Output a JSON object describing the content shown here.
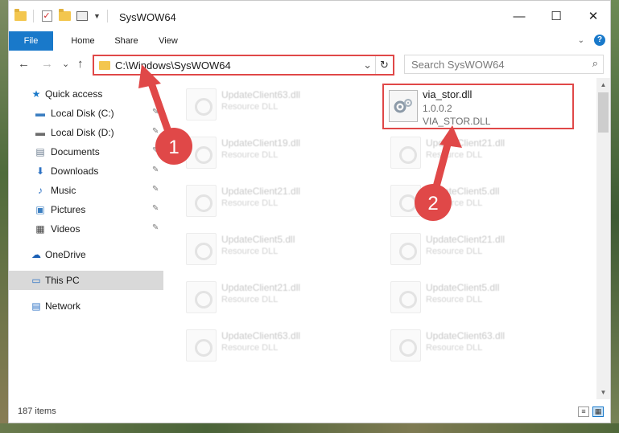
{
  "window": {
    "title": "SysWOW64",
    "controls": {
      "minimize": "—",
      "maximize": "☐",
      "close": "✕"
    }
  },
  "ribbon": {
    "tabs": [
      {
        "label": "File"
      },
      {
        "label": "Home"
      },
      {
        "label": "Share"
      },
      {
        "label": "View"
      }
    ],
    "collapse_glyph": "⌄",
    "help_glyph": "?"
  },
  "nav": {
    "back": "←",
    "forward": "→",
    "recent": "⌄",
    "up": "↑"
  },
  "address": {
    "path": "C:\\Windows\\SysWOW64",
    "drop_glyph": "⌄",
    "refresh_glyph": "↻"
  },
  "search": {
    "placeholder": "Search SysWOW64",
    "icon_glyph": "⌕"
  },
  "sidebar": {
    "items": [
      {
        "label": "Quick access",
        "icon": "star-icon",
        "glyph": "★",
        "color": "#1979ca"
      },
      {
        "label": "Local Disk (C:)",
        "icon": "drive-icon",
        "glyph": "▬",
        "color": "#3c7fc1",
        "pinned": true
      },
      {
        "label": "Local Disk (D:)",
        "icon": "drive-icon",
        "glyph": "▬",
        "color": "#6b6b6b",
        "pinned": true
      },
      {
        "label": "Documents",
        "icon": "documents-icon",
        "glyph": "▤",
        "color": "#6b7c8f",
        "pinned": true
      },
      {
        "label": "Downloads",
        "icon": "download-arrow-icon",
        "glyph": "⬇",
        "color": "#2d72c4",
        "pinned": true
      },
      {
        "label": "Music",
        "icon": "music-note-icon",
        "glyph": "♪",
        "color": "#2d72c4",
        "pinned": true
      },
      {
        "label": "Pictures",
        "icon": "pictures-icon",
        "glyph": "▣",
        "color": "#3c7fc1",
        "pinned": true
      },
      {
        "label": "Videos",
        "icon": "film-icon",
        "glyph": "▦",
        "color": "#444444",
        "pinned": true
      },
      {
        "label": "OneDrive",
        "icon": "cloud-icon",
        "glyph": "☁",
        "color": "#1a5fb4"
      },
      {
        "label": "This PC",
        "icon": "monitor-icon",
        "glyph": "▭",
        "color": "#2d72c4",
        "selected": true
      },
      {
        "label": "Network",
        "icon": "network-icon",
        "glyph": "▤",
        "color": "#2d72c4"
      }
    ],
    "pin_glyph": "📌"
  },
  "files": [
    {
      "name": "UpdateClient63.dll",
      "type": "Resource DLL"
    },
    {
      "name": "UpdateClient19.dll",
      "type": "Resource DLL"
    },
    {
      "name": "UpdateClient21.dll",
      "type": "Resource DLL"
    },
    {
      "name": "UpdateClient21.dll",
      "type": "Resource DLL"
    },
    {
      "name": "UpdateClient5.dll",
      "type": "Resource DLL"
    },
    {
      "name": "UpdateClient5.dll",
      "type": "Resource DLL"
    },
    {
      "name": "UpdateClient21.dll",
      "type": "Resource DLL"
    },
    {
      "name": "UpdateClient21.dll",
      "type": "Resource DLL"
    },
    {
      "name": "UpdateClient5.dll",
      "type": "Resource DLL"
    },
    {
      "name": "UpdateClient63.dll",
      "type": "Resource DLL"
    },
    {
      "name": "UpdateClient63.dll",
      "type": "Resource DLL"
    }
  ],
  "highlighted_file": {
    "name": "via_stor.dll",
    "version": "1.0.0.2",
    "description": "VIA_STOR.DLL"
  },
  "status": {
    "item_count": "187 items",
    "view_details_glyph": "≡",
    "view_tiles_glyph": "▦"
  },
  "annotations": {
    "step1": "1",
    "step2": "2",
    "color": "#e04848"
  }
}
